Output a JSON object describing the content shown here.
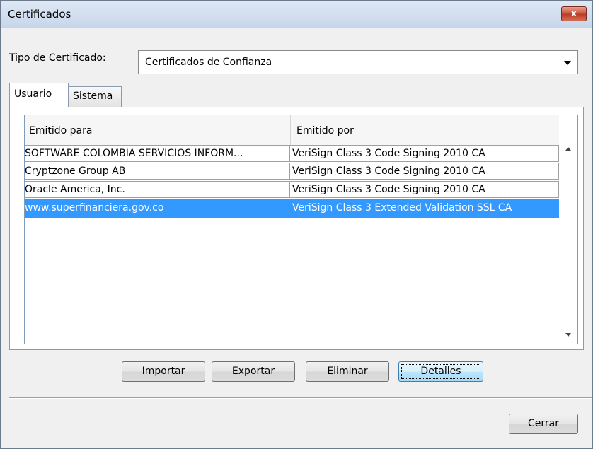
{
  "window": {
    "title": "Certificados",
    "close_label": "x"
  },
  "tipo": {
    "label": "Tipo de Certificado:",
    "value": "Certificados de Confianza"
  },
  "tabs": [
    {
      "label": "Usuario",
      "selected": true
    },
    {
      "label": "Sistema",
      "selected": false
    }
  ],
  "table": {
    "columns": [
      "Emitido para",
      "Emitido por"
    ],
    "rows": [
      {
        "emitido_para": "SOFTWARE COLOMBIA SERVICIOS INFORM...",
        "emitido_por": "VeriSign Class 3 Code Signing 2010 CA",
        "selected": false
      },
      {
        "emitido_para": "Cryptzone Group AB",
        "emitido_por": "VeriSign Class 3 Code Signing 2010 CA",
        "selected": false
      },
      {
        "emitido_para": "Oracle America, Inc.",
        "emitido_por": "VeriSign Class 3 Code Signing 2010 CA",
        "selected": false
      },
      {
        "emitido_para": "www.superfinanciera.gov.co",
        "emitido_por": "VeriSign Class 3 Extended Validation SSL CA",
        "selected": true
      }
    ]
  },
  "buttons": {
    "importar": "Importar",
    "exportar": "Exportar",
    "eliminar": "Eliminar",
    "detalles": "Detalles",
    "cerrar": "Cerrar"
  },
  "colors": {
    "selection": "#3399ff",
    "titlebar": "#c6d6ea",
    "close": "#c8503a"
  }
}
